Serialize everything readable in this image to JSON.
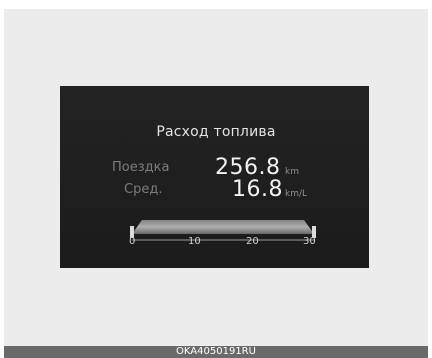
{
  "display": {
    "title": "Расход топлива",
    "trip_label": "Поездка",
    "trip_value": "256.8",
    "trip_unit": "km",
    "avg_label": "Сред.",
    "avg_value": "16.8",
    "avg_unit": "km/L"
  },
  "gauge": {
    "ticks": [
      "0",
      "10",
      "20",
      "30"
    ],
    "fill_fraction": 1.0
  },
  "footer": {
    "code": "OKA4050191RU"
  },
  "colors": {
    "screen": "#1e1e1e",
    "frame": "#ececec",
    "footer": "#6a6a6a"
  }
}
